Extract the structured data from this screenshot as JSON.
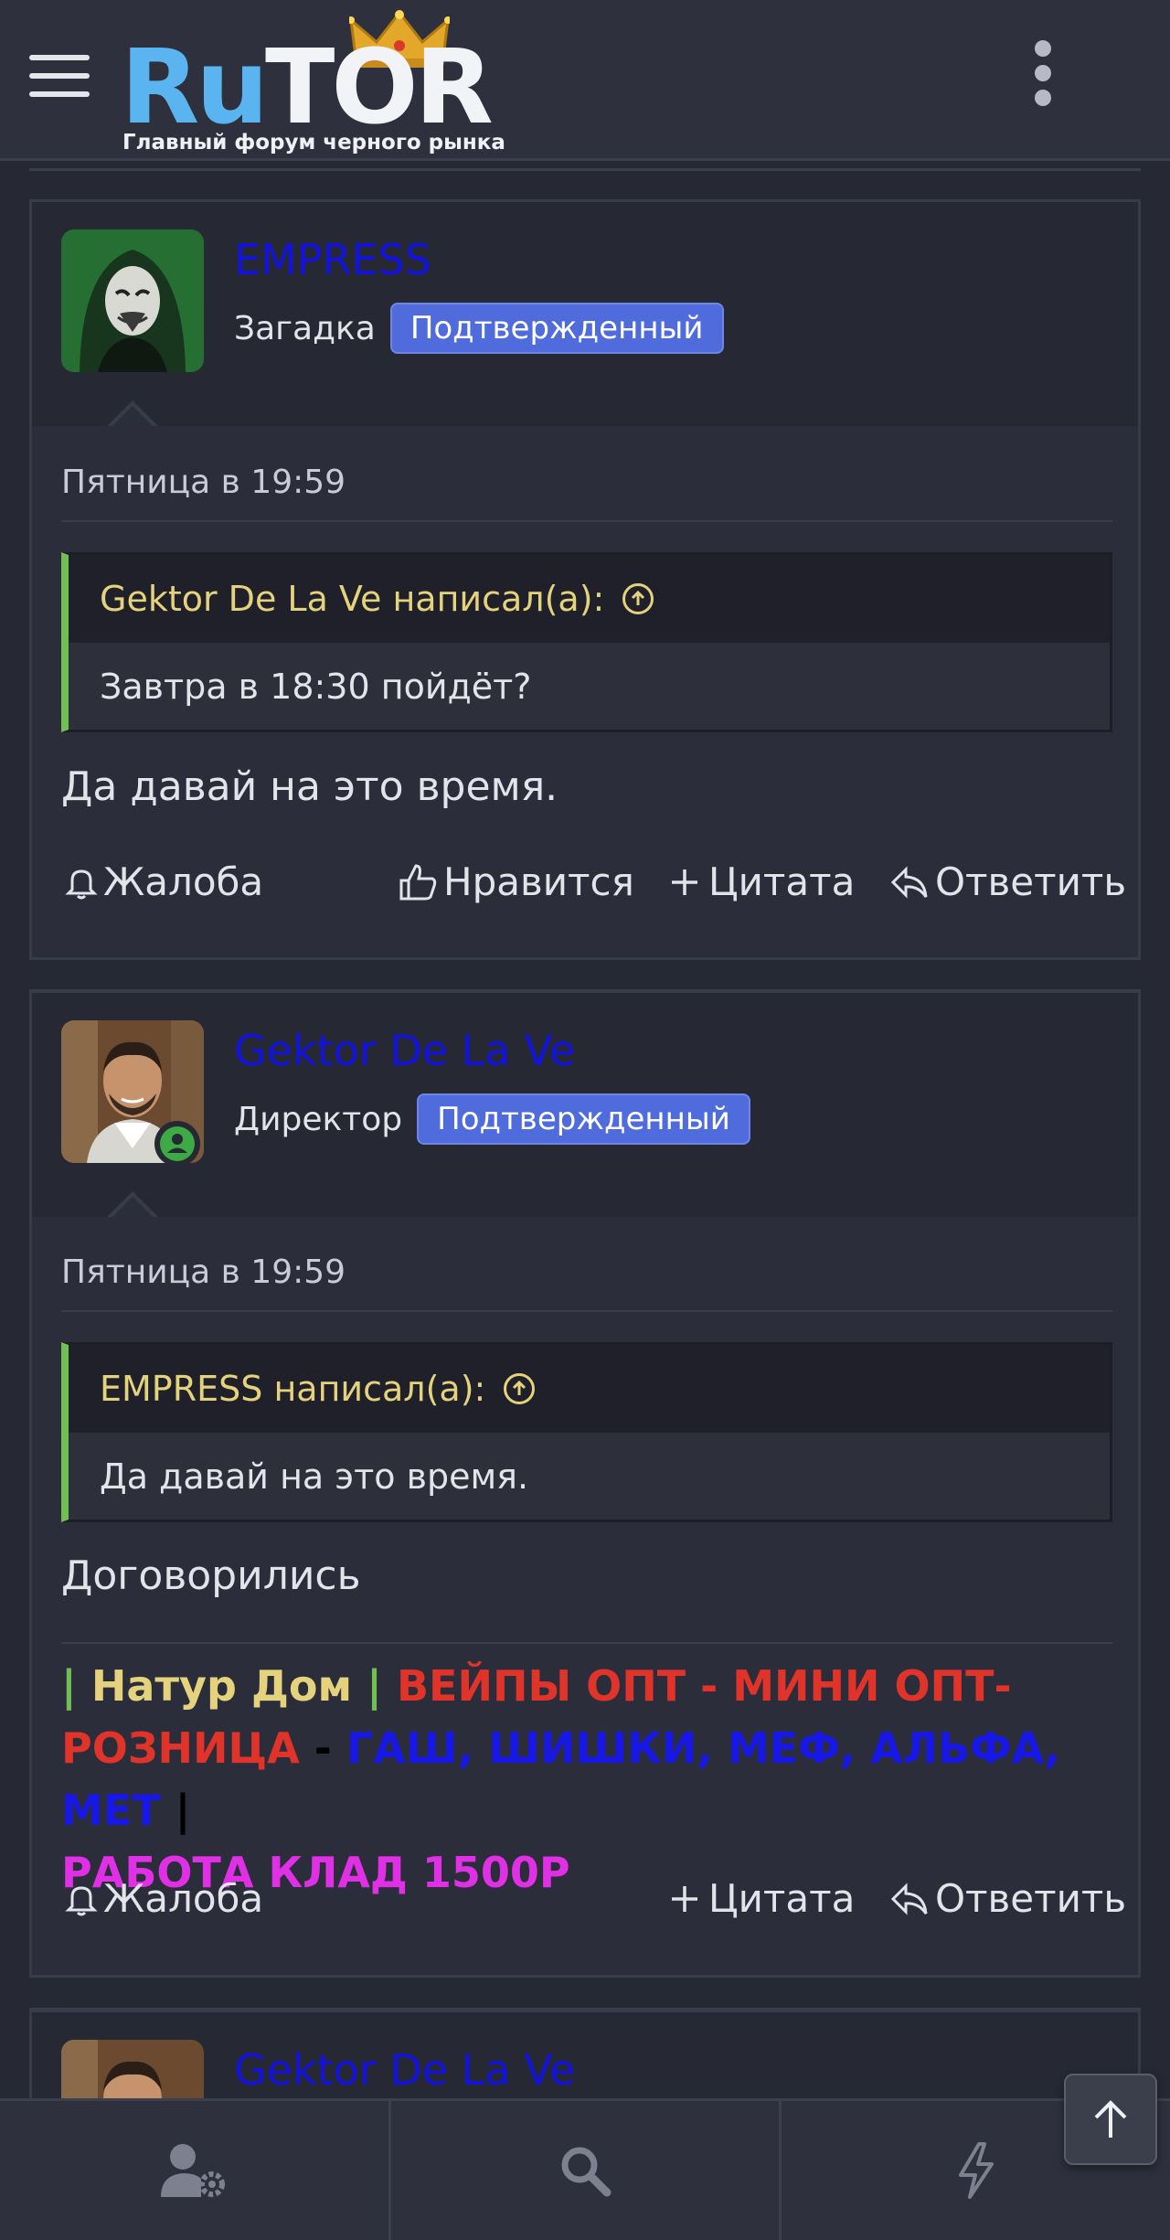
{
  "header": {
    "logo_ru": "Ru",
    "logo_tor": "TOR",
    "logo_subtitle": "Главный форум черного рынка"
  },
  "posts": [
    {
      "username": "EMPRESS",
      "user_title": "Загадка",
      "badge": "Подтвержденный",
      "date": "Пятница в 19:59",
      "quote_author": "Gektor De La Ve написал(а):",
      "quote_text": "Завтра в 18:30 пойдёт?",
      "message": "Да давай на это время.",
      "actions": {
        "report": "Жалоба",
        "like": "Нравится",
        "quote": "Цитата",
        "reply": "Ответить"
      }
    },
    {
      "username": "Gektor De La Ve",
      "user_title": "Директор",
      "badge": "Подтвержденный",
      "date": "Пятница в 19:59",
      "quote_author": "EMPRESS написал(а):",
      "quote_text": "Да давай на это время.",
      "message": "Договорились",
      "signature": {
        "bar1": "|",
        "shop": " Натур Дом ",
        "bar2": "|",
        "vapes": " ВЕЙПЫ ОПТ - МИНИ ОПТ- РОЗНИЦА ",
        "dash": "-",
        "goods": " ГАШ, ШИШКИ, МЕФ, АЛЬФА, МЕТ ",
        "bar3": "|",
        "job": "РАБОТА КЛАД 1500Р"
      },
      "actions": {
        "report": "Жалоба",
        "quote": "Цитата",
        "reply": "Ответить"
      }
    },
    {
      "username": "Gektor De La Ve"
    }
  ],
  "colors": {
    "username": "#1313e0",
    "badge": "#4f6bdc",
    "quote_bar": "#6fbf52",
    "quote_author": "#e5d27d",
    "sig_shop": "#e5d27d",
    "sig_red": "#e0332a",
    "sig_blue": "#1818e6",
    "sig_magenta": "#e030e6"
  },
  "footer": {
    "icons": [
      "user-settings-icon",
      "search-icon",
      "lightning-icon"
    ]
  }
}
